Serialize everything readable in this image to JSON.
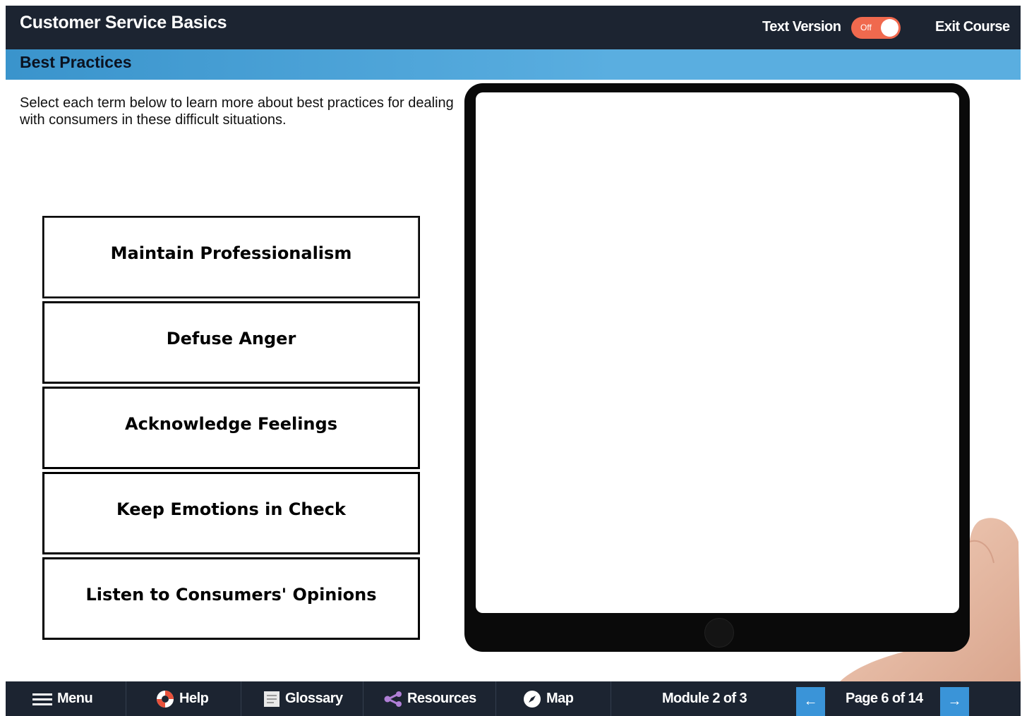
{
  "header": {
    "course_title": "Customer Service Basics",
    "text_version_label": "Text Version",
    "toggle_state": "Off",
    "exit_label": "Exit Course"
  },
  "section": {
    "title": "Best Practices"
  },
  "content": {
    "instruction": "Select each term below to learn more about best practices for dealing with consumers in these difficult situations.",
    "terms": [
      {
        "label": "Maintain Professionalism"
      },
      {
        "label": "Defuse Anger"
      },
      {
        "label": "Acknowledge Feelings"
      },
      {
        "label": "Keep Emotions in Check"
      },
      {
        "label": "Listen to Consumers' Opinions"
      }
    ]
  },
  "footer": {
    "menu_label": "Menu",
    "help_label": "Help",
    "glossary_label": "Glossary",
    "resources_label": "Resources",
    "map_label": "Map",
    "module_text": "Module 2 of 3",
    "prev_arrow": "←",
    "page_text": "Page 6 of 14",
    "next_arrow": "→"
  },
  "colors": {
    "header_bg": "#1c2431",
    "section_bar": "#4ea6dc",
    "toggle": "#f0694e",
    "nav_arrow": "#3a94d8"
  },
  "icons": {
    "menu": "hamburger-icon",
    "help": "lifebuoy-icon",
    "glossary": "book-icon",
    "resources": "share-icon",
    "map": "compass-icon"
  }
}
